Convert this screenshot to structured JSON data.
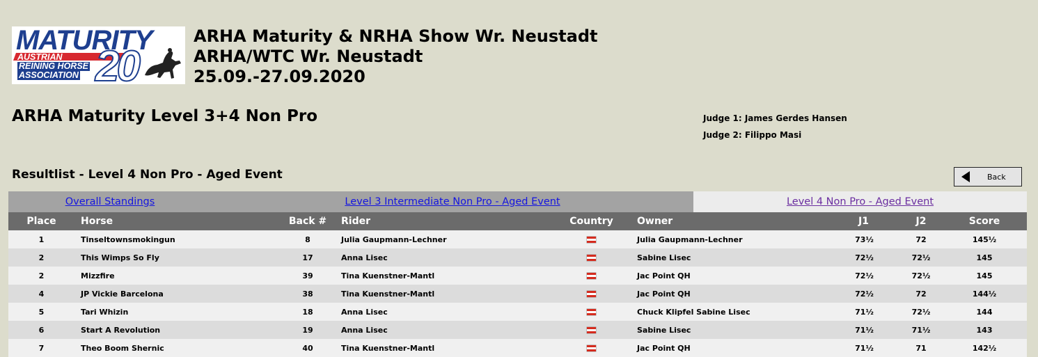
{
  "logo": {
    "main_text": "MATURITY",
    "number": "20",
    "lines": [
      "AUSTRIAN",
      "REINING HORSE",
      "ASSOCIATION"
    ]
  },
  "event": {
    "line1": "ARHA Maturity & NRHA Show Wr. Neustadt",
    "line2": "ARHA/WTC Wr. Neustadt",
    "line3": "25.09.-27.09.2020"
  },
  "class_title": "ARHA Maturity Level 3+4 Non Pro",
  "judges": {
    "judge1": "Judge 1: James Gerdes Hansen",
    "judge2": "Judge 2: Filippo Masi"
  },
  "resultlist_title": "Resultlist - Level 4 Non Pro - Aged Event",
  "back_button": {
    "label": "Back",
    "icon": "arrow-left-icon"
  },
  "tabs": [
    {
      "label": "Overall Standings"
    },
    {
      "label": "Level 3 Intermediate Non Pro - Aged Event"
    },
    {
      "label": "Level 4 Non Pro - Aged Event"
    }
  ],
  "table": {
    "headers": {
      "place": "Place",
      "horse": "Horse",
      "back": "Back #",
      "rider": "Rider",
      "country": "Country",
      "owner": "Owner",
      "j1": "J1",
      "j2": "J2",
      "score": "Score"
    },
    "rows": [
      {
        "place": "1",
        "horse": "Tinseltownsmokingun",
        "back": "8",
        "rider": "Julia Gaupmann-Lechner",
        "country": "austria-flag",
        "owner": "Julia Gaupmann-Lechner",
        "j1": "73½",
        "j2": "72",
        "score": "145½"
      },
      {
        "place": "2",
        "horse": "This Wimps So Fly",
        "back": "17",
        "rider": "Anna Lisec",
        "country": "austria-flag",
        "owner": "Sabine Lisec",
        "j1": "72½",
        "j2": "72½",
        "score": "145"
      },
      {
        "place": "2",
        "horse": "Mizzfire",
        "back": "39",
        "rider": "Tina Kuenstner-Mantl",
        "country": "austria-flag",
        "owner": "Jac Point QH",
        "j1": "72½",
        "j2": "72½",
        "score": "145"
      },
      {
        "place": "4",
        "horse": "JP Vickie Barcelona",
        "back": "38",
        "rider": "Tina Kuenstner-Mantl",
        "country": "austria-flag",
        "owner": "Jac Point QH",
        "j1": "72½",
        "j2": "72",
        "score": "144½"
      },
      {
        "place": "5",
        "horse": "Tari Whizin",
        "back": "18",
        "rider": "Anna Lisec",
        "country": "austria-flag",
        "owner": "Chuck Klipfel Sabine Lisec",
        "j1": "71½",
        "j2": "72½",
        "score": "144"
      },
      {
        "place": "6",
        "horse": "Start A Revolution",
        "back": "19",
        "rider": "Anna Lisec",
        "country": "austria-flag",
        "owner": "Sabine Lisec",
        "j1": "71½",
        "j2": "71½",
        "score": "143"
      },
      {
        "place": "7",
        "horse": "Theo Boom Shernic",
        "back": "40",
        "rider": "Tina Kuenstner-Mantl",
        "country": "austria-flag",
        "owner": "Jac Point QH",
        "j1": "71½",
        "j2": "71",
        "score": "142½"
      }
    ]
  },
  "colors": {
    "page_bg": "#dcdccc",
    "tab_inactive_bg": "#a3a3a3",
    "tab_active_bg": "#ececec",
    "header_bg": "#6b6b6b",
    "link": "#1515e0",
    "visited_link": "#6b2ea0",
    "logo_blue": "#1e3f8f",
    "logo_red": "#d7282f"
  }
}
